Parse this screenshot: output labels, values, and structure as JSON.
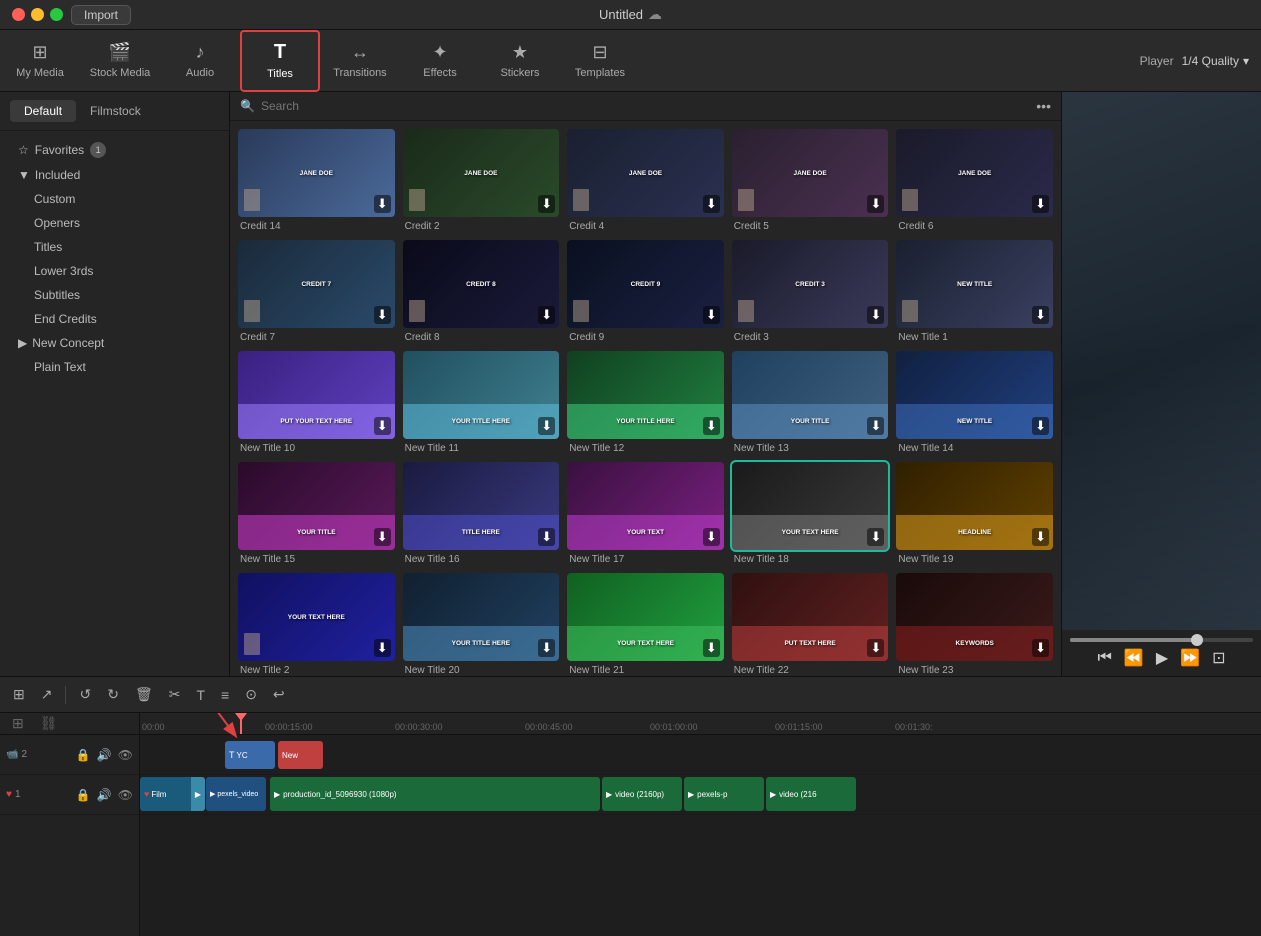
{
  "titleBar": {
    "importLabel": "Import",
    "title": "Untitled",
    "cloudIcon": "☁"
  },
  "topNav": {
    "items": [
      {
        "id": "my-media",
        "icon": "⊞",
        "label": "My Media",
        "active": false
      },
      {
        "id": "stock-media",
        "icon": "🎬",
        "label": "Stock Media",
        "active": false
      },
      {
        "id": "audio",
        "icon": "♪",
        "label": "Audio",
        "active": false
      },
      {
        "id": "titles",
        "icon": "T",
        "label": "Titles",
        "active": true
      },
      {
        "id": "transitions",
        "icon": "↔",
        "label": "Transitions",
        "active": false
      },
      {
        "id": "effects",
        "icon": "✦",
        "label": "Effects",
        "active": false
      },
      {
        "id": "stickers",
        "icon": "★",
        "label": "Stickers",
        "active": false
      },
      {
        "id": "templates",
        "icon": "⊟",
        "label": "Templates",
        "active": false
      }
    ],
    "playerLabel": "Player",
    "qualityLabel": "1/4 Quality"
  },
  "sidebar": {
    "tabs": [
      {
        "id": "default",
        "label": "Default",
        "active": true
      },
      {
        "id": "filmstock",
        "label": "Filmstock",
        "active": false
      }
    ],
    "favoritesLabel": "Favorites",
    "favoritesBadge": "1",
    "sections": [
      {
        "id": "included",
        "label": "Included",
        "expanded": true,
        "items": [
          {
            "id": "custom",
            "label": "Custom"
          },
          {
            "id": "openers",
            "label": "Openers"
          },
          {
            "id": "titles",
            "label": "Titles"
          },
          {
            "id": "lower3rds",
            "label": "Lower 3rds"
          },
          {
            "id": "subtitles",
            "label": "Subtitles"
          },
          {
            "id": "endcredits",
            "label": "End Credits"
          }
        ]
      },
      {
        "id": "new-concept",
        "label": "New Concept",
        "expanded": false,
        "items": []
      }
    ],
    "plainTextLabel": "Plain Text"
  },
  "search": {
    "placeholder": "Search"
  },
  "grid": {
    "items": [
      {
        "id": "credit14",
        "label": "Credit 14",
        "thumbClass": "thumb-credit14",
        "text": "JANE DOE",
        "selected": false
      },
      {
        "id": "credit2",
        "label": "Credit 2",
        "thumbClass": "thumb-credit2",
        "text": "JANE DOE",
        "selected": false
      },
      {
        "id": "credit4",
        "label": "Credit 4",
        "thumbClass": "thumb-credit4",
        "text": "JANE DOE",
        "selected": false
      },
      {
        "id": "credit5",
        "label": "Credit 5",
        "thumbClass": "thumb-credit5",
        "text": "JANE DOE",
        "selected": false
      },
      {
        "id": "credit6",
        "label": "Credit 6",
        "thumbClass": "thumb-credit6",
        "text": "JANE DOE",
        "selected": false
      },
      {
        "id": "credit7",
        "label": "Credit 7",
        "thumbClass": "thumb-credit7",
        "text": "CREDIT 7",
        "selected": false
      },
      {
        "id": "credit8",
        "label": "Credit 8",
        "thumbClass": "thumb-credit8",
        "text": "CREDIT 8",
        "selected": false
      },
      {
        "id": "credit9",
        "label": "Credit 9",
        "thumbClass": "thumb-credit9",
        "text": "CREDIT 9",
        "selected": false
      },
      {
        "id": "credit3",
        "label": "Credit 3",
        "thumbClass": "thumb-credit3",
        "text": "CREDIT 3",
        "selected": false
      },
      {
        "id": "newtitle1",
        "label": "New Title 1",
        "thumbClass": "thumb-newtitle1",
        "text": "NEW TITLE",
        "selected": false
      },
      {
        "id": "newtitle10",
        "label": "New Title 10",
        "thumbClass": "thumb-newtitle10",
        "text": "PUT YOUR TEXT HERE",
        "selected": false
      },
      {
        "id": "newtitle11",
        "label": "New Title 11",
        "thumbClass": "thumb-newtitle11",
        "text": "YOUR TITLE HERE",
        "selected": false
      },
      {
        "id": "newtitle12",
        "label": "New Title 12",
        "thumbClass": "thumb-newtitle12",
        "text": "YOUR TITLE HERE",
        "selected": false
      },
      {
        "id": "newtitle13",
        "label": "New Title 13",
        "thumbClass": "thumb-newtitle13",
        "text": "YOUR TITLE",
        "selected": false
      },
      {
        "id": "newtitle14",
        "label": "New Title 14",
        "thumbClass": "thumb-newtitle14",
        "text": "NEW TITLE",
        "selected": false
      },
      {
        "id": "newtitle15",
        "label": "New Title 15",
        "thumbClass": "thumb-newtitle15",
        "text": "YOUR TITLE",
        "selected": false
      },
      {
        "id": "newtitle16",
        "label": "New Title 16",
        "thumbClass": "thumb-newtitle16",
        "text": "TITLE HERE",
        "selected": false
      },
      {
        "id": "newtitle17",
        "label": "New Title 17",
        "thumbClass": "thumb-newtitle17",
        "text": "YOUR TEXT",
        "selected": false
      },
      {
        "id": "newtitle18",
        "label": "New Title 18",
        "thumbClass": "thumb-newtitle18",
        "text": "YOUR TEXT HERE",
        "selected": true
      },
      {
        "id": "newtitle19",
        "label": "New Title 19",
        "thumbClass": "thumb-newtitle19",
        "text": "HEADLINE",
        "selected": false
      },
      {
        "id": "newtitle2",
        "label": "New Title 2",
        "thumbClass": "thumb-newtitle2",
        "text": "YOUR TEXT HERE",
        "selected": false
      },
      {
        "id": "newtitle20",
        "label": "New Title 20",
        "thumbClass": "thumb-newtitle20",
        "text": "YOUR TITLE HERE",
        "selected": false
      },
      {
        "id": "newtitle21",
        "label": "New Title 21",
        "thumbClass": "thumb-newtitle21",
        "text": "YOUR TEXT HERE",
        "selected": false
      },
      {
        "id": "newtitle22",
        "label": "New Title 22",
        "thumbClass": "thumb-newtitle22",
        "text": "PUT TEXT HERE",
        "selected": false
      },
      {
        "id": "newtitle23",
        "label": "New Title 23",
        "thumbClass": "thumb-newtitle23",
        "text": "KEYWORDS",
        "selected": false
      }
    ]
  },
  "timeline": {
    "tools": [
      "⊞",
      "↗",
      "|",
      "↺",
      "↻",
      "🗑",
      "✂",
      "T",
      "≡",
      "⊙",
      "↩"
    ],
    "rulerMarks": [
      "00:00",
      "00:00:15:00",
      "00:00:30:00",
      "00:00:45:00",
      "00:01:00:00",
      "00:01:15:00",
      "00:01:30:"
    ],
    "tracks": [
      {
        "num": "2",
        "clips": [
          {
            "label": "YC",
            "type": "title",
            "color": "#3a6aaa"
          },
          {
            "label": "New",
            "type": "title-new",
            "color": "#e04040"
          }
        ]
      },
      {
        "num": "1",
        "clips": [
          {
            "label": "Film",
            "type": "video",
            "color": "#1a5a3a"
          },
          {
            "label": "pexels_video",
            "type": "video",
            "color": "#2a5a8a"
          },
          {
            "label": "production_id_5096930 (1080p)",
            "type": "video",
            "color": "#2a7a4a"
          },
          {
            "label": "video (2160p)",
            "type": "video",
            "color": "#2a7a4a"
          },
          {
            "label": "pexels-p",
            "type": "video",
            "color": "#2a7a4a"
          },
          {
            "label": "video (216",
            "type": "video",
            "color": "#2a7a4a"
          }
        ]
      }
    ]
  }
}
